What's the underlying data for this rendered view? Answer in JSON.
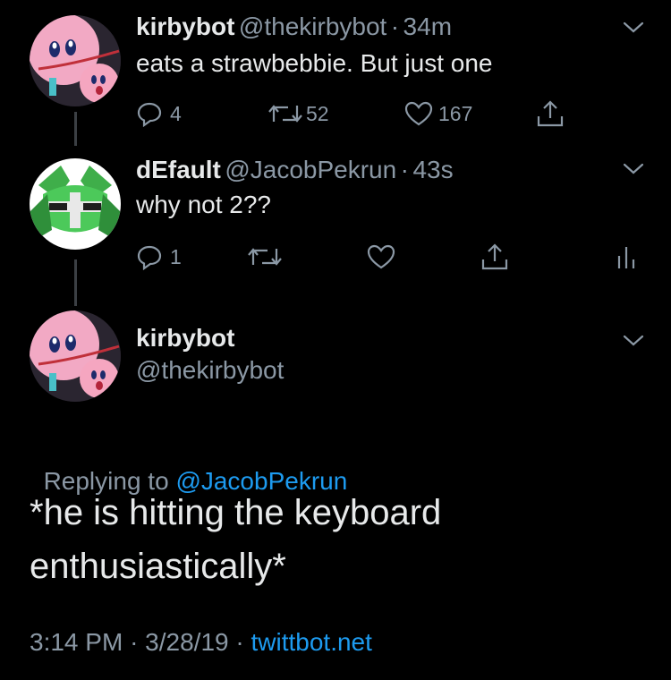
{
  "tweet1": {
    "name": "kirbybot",
    "handle": "@thekirbybot",
    "sep": "·",
    "time": "34m",
    "text": "eats a strawbebbie. But just one",
    "reply_count": "4",
    "retweet_count": "52",
    "like_count": "167"
  },
  "tweet2": {
    "name": "dEfault",
    "handle": "@JacobPekrun",
    "sep": "·",
    "time": "43s",
    "text": "why not 2??",
    "reply_count": "1"
  },
  "tweet3": {
    "name": "kirbybot",
    "handle": "@thekirbybot",
    "replying_prefix": "Replying to ",
    "replying_to": "@JacobPekrun",
    "text_line1": "*he is hitting the keyboard",
    "text_line2": "enthusiastically*",
    "time": "3:14 PM",
    "sep1": "·",
    "date": "3/28/19",
    "sep2": "·",
    "source": "twittbot.net"
  },
  "colors": {
    "background": "#000000",
    "text": "#e7e9ea",
    "secondary": "#8b98a5",
    "link": "#1d9bf0"
  },
  "icons": [
    "reply-icon",
    "retweet-icon",
    "like-icon",
    "share-icon",
    "analytics-icon",
    "chevron-down-icon"
  ]
}
